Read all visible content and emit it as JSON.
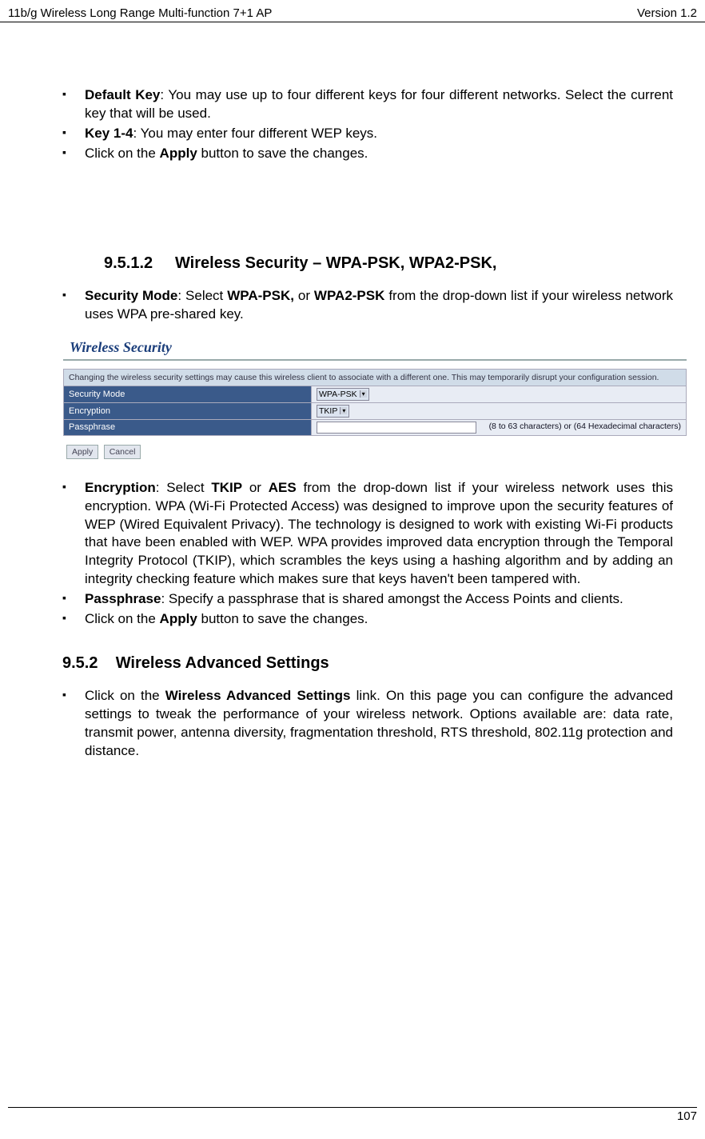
{
  "header": {
    "left": "11b/g Wireless Long Range Multi-function 7+1 AP",
    "right": "Version 1.2"
  },
  "footer": {
    "page": "107"
  },
  "topBullets": [
    {
      "bold": "Default Key",
      "text": ": You may use up to four different keys for four different networks. Select the current key that will be used."
    },
    {
      "bold": "Key 1-4",
      "text": ": You may enter four different WEP keys."
    },
    {
      "prefix": "Click on the ",
      "bold": "Apply",
      "text": " button to save the changes."
    }
  ],
  "section1": {
    "num": "9.5.1.2",
    "title": "Wireless Security – WPA-PSK, WPA2-PSK,"
  },
  "securityModeBullet": {
    "bold1": "Security Mode",
    "text1": ": Select ",
    "bold2": "WPA-PSK,",
    "text2": " or ",
    "bold3": "WPA2-PSK",
    "text3": " from the drop-down list if your wireless network uses WPA pre-shared key."
  },
  "screenshot": {
    "title": "Wireless Security",
    "notice": "Changing the wireless security settings may cause this wireless client to associate with a different one. This may temporarily disrupt your configuration session.",
    "rows": {
      "securityMode": {
        "label": "Security Mode",
        "value": "WPA-PSK"
      },
      "encryption": {
        "label": "Encryption",
        "value": "TKIP"
      },
      "passphrase": {
        "label": "Passphrase",
        "hint": "(8 to 63 characters) or (64 Hexadecimal characters)"
      }
    },
    "buttons": {
      "apply": "Apply",
      "cancel": "Cancel"
    }
  },
  "bottomBullets": [
    {
      "bold1": "Encryption",
      "text1": ": Select ",
      "bold2": "TKIP",
      "text2": " or ",
      "bold3": "AES",
      "text3": " from the drop-down list if your wireless network uses this encryption. WPA (Wi-Fi Protected Access) was designed to improve upon the security features of WEP (Wired Equivalent Privacy). The technology is designed to work with existing Wi-Fi products that have been enabled with WEP. WPA provides improved data encryption through the Temporal Integrity Protocol (TKIP), which scrambles the keys using a hashing algorithm and by adding an integrity checking feature which makes sure that keys haven't been tampered with."
    },
    {
      "bold1": "Passphrase",
      "text1": ": Specify a passphrase that is shared amongst the Access Points and clients."
    },
    {
      "prefix": "Click on the ",
      "bold1": "Apply",
      "text1": " button to save the changes."
    }
  ],
  "section2": {
    "num": "9.5.2",
    "title": "Wireless Advanced Settings"
  },
  "advancedBullet": {
    "prefix": "Click on the ",
    "bold": "Wireless Advanced Settings",
    "text": " link. On this page you can configure the advanced settings to tweak the performance of your wireless network. Options available are: data rate, transmit power, antenna diversity, fragmentation threshold, RTS threshold, 802.11g protection and distance."
  }
}
